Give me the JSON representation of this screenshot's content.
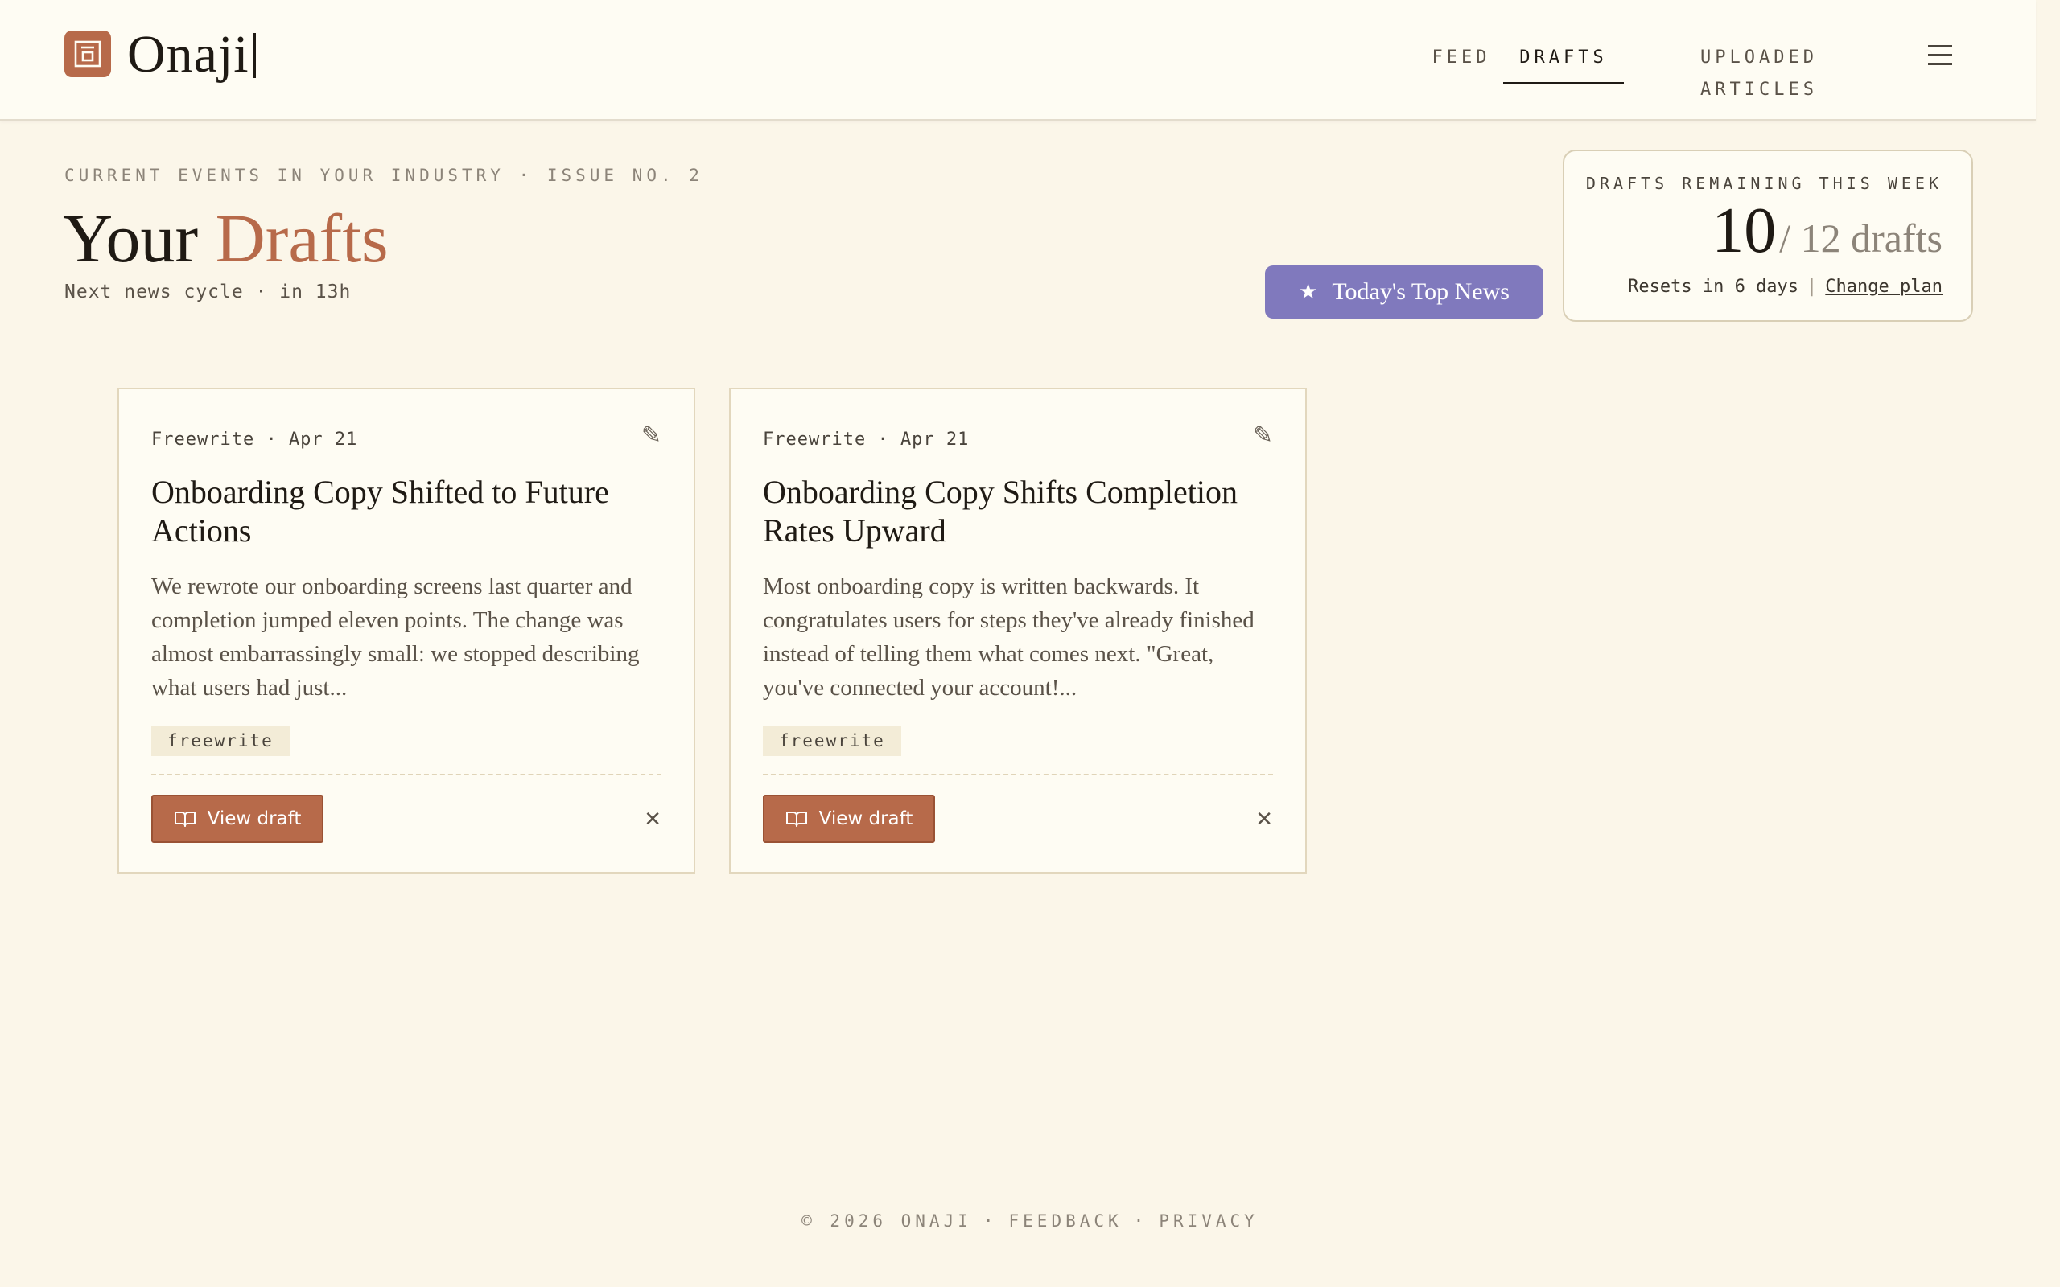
{
  "brand": {
    "name": "Onaji",
    "logo_icon": "logo-mark-icon"
  },
  "nav": {
    "items": [
      {
        "label": "FEED",
        "active": false
      },
      {
        "label": "DRAFTS",
        "active": true
      },
      {
        "label": "UPLOADED ARTICLES",
        "active": false
      }
    ],
    "menu_icon": "hamburger-menu-icon"
  },
  "page": {
    "eyebrow": "CURRENT EVENTS IN YOUR INDUSTRY · ISSUE NO. 2",
    "title_prefix": "Your",
    "title_accent": "Drafts",
    "subline": "Next news cycle · in 13h",
    "top_news_label": "Today's Top News",
    "top_news_icon": "star-icon"
  },
  "quota": {
    "label": "DRAFTS REMAINING THIS WEEK",
    "remaining": "10",
    "total_text": "/ 12 drafts",
    "resets_text": "Resets in 6 days",
    "separator": "|",
    "change_plan_label": "Change plan"
  },
  "cards": [
    {
      "meta": "Freewrite · Apr 21",
      "title": "Onboarding Copy Shifted to Future Actions",
      "excerpt": "We rewrote our onboarding screens last quarter and completion jumped eleven points. The change was almost embarrassingly small: we stopped describing what users had just...",
      "tag": "freewrite",
      "view_label": "View draft",
      "edit_icon": "pencil-icon",
      "dismiss_icon": "close-icon"
    },
    {
      "meta": "Freewrite · Apr 21",
      "title": "Onboarding Copy Shifts Completion Rates Upward",
      "excerpt": "Most onboarding copy is written backwards. It congratulates users for steps they've already finished instead of telling them what comes next. \"Great, you've connected your account!...",
      "tag": "freewrite",
      "view_label": "View draft",
      "edit_icon": "pencil-icon",
      "dismiss_icon": "close-icon"
    }
  ],
  "footer": {
    "copyright": "© 2026 ONAJI",
    "feedback": "FEEDBACK",
    "privacy": "PRIVACY",
    "separator": "·"
  },
  "colors": {
    "background": "#fbf6e9",
    "header": "#fefcf3",
    "accent": "#b76a4a",
    "top_news_button": "#8079bd",
    "text": "#1f1a14",
    "muted": "#8c8479"
  }
}
